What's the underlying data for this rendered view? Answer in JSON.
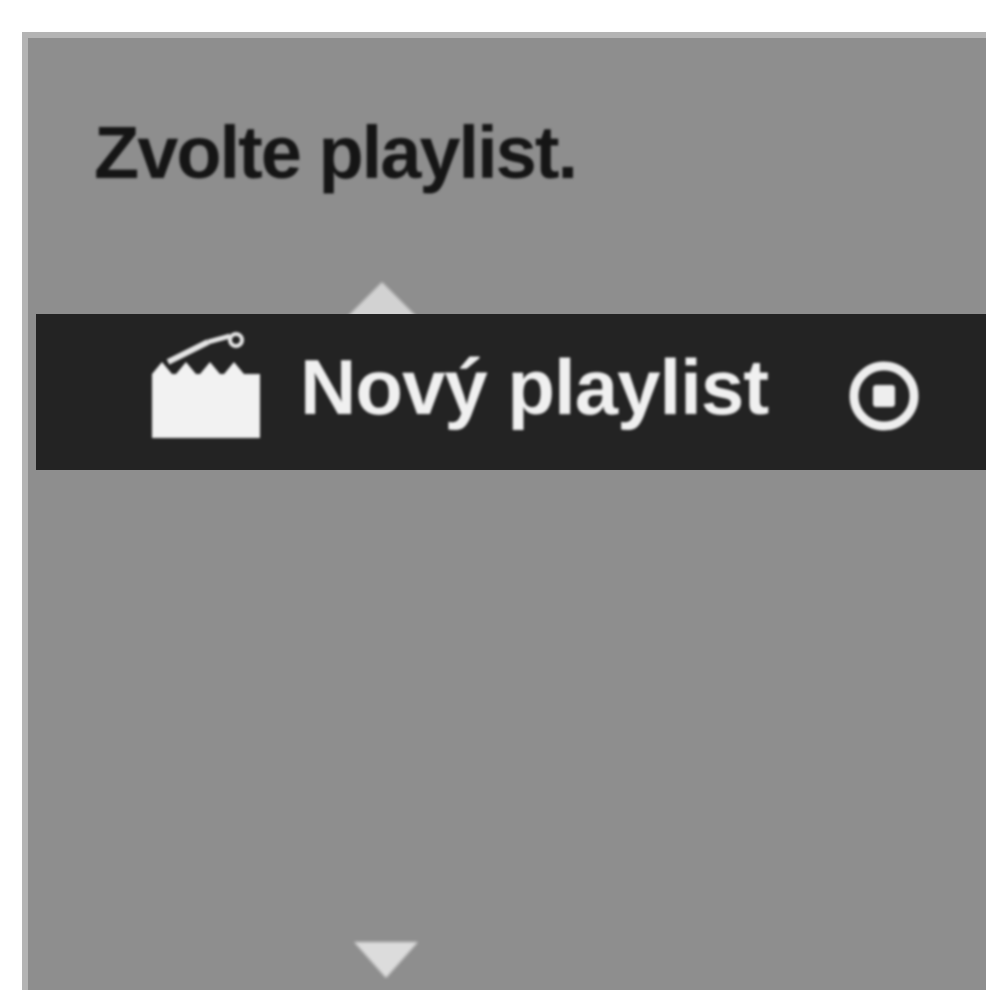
{
  "dialog": {
    "title": "Zvolte playlist.",
    "scroll_up_icon": "triangle-up-icon",
    "scroll_down_icon": "triangle-down-icon"
  },
  "playlist_items": [
    {
      "label": "Nový playlist",
      "icon": "new-playlist-icon",
      "select_icon": "circle-dot-icon",
      "highlighted": true
    }
  ],
  "colors": {
    "panel_background": "#8e8e8e",
    "highlight_row": "#232323",
    "highlight_text": "#f0f0f0",
    "title_text": "#151515"
  }
}
